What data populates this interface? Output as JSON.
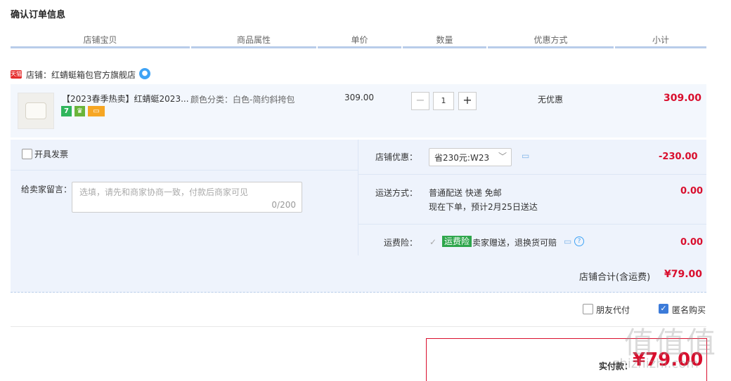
{
  "page_title": "确认订单信息",
  "columns": [
    "店铺宝贝",
    "商品属性",
    "单价",
    "数量",
    "优惠方式",
    "小计"
  ],
  "shop": {
    "badge": "天猫",
    "name": "店铺：红蜻蜓箱包官方旗舰店",
    "chat_icon": "chat-icon"
  },
  "item": {
    "title": "【2023春季热卖】红蜻蜓2023...",
    "attribute": "颜色分类：白色-简约斜挎包",
    "unit_price": "309.00",
    "quantity": "1",
    "minus_label": "−",
    "plus_label": "+",
    "promotion": "无优惠",
    "subtotal": "309.00",
    "tags": [
      {
        "text": "7",
        "color": "#2fb55c"
      },
      {
        "text": "♛",
        "color": "#69b43a"
      },
      {
        "text": "▭",
        "color": "#f6a623"
      }
    ]
  },
  "invoice": {
    "label": "开具发票"
  },
  "message": {
    "label": "给卖家留言：",
    "placeholder": "选填，请先和商家协商一致，付款后商家可见",
    "count": "0/200"
  },
  "discount": {
    "label": "店铺优惠：",
    "selected": "省230元:W23",
    "amount": "-230.00"
  },
  "shipping": {
    "label": "运送方式：",
    "method": "普通配送 快递 免邮",
    "eta": "现在下单，预计2月25日送达",
    "fee": "0.00"
  },
  "insurance": {
    "label": "运费险：",
    "badge": "运费险",
    "desc": "卖家赠送，退换货可赔",
    "fee": "0.00"
  },
  "shop_total": {
    "label": "店铺合计(含运费)",
    "value": "¥79.00"
  },
  "options": {
    "friend_pay": "朋友代付",
    "anonymous": "匿名购买"
  },
  "payment": {
    "label": "实付款：",
    "value": "¥79.00"
  },
  "watermark": {
    "big": "值值值",
    "small": "zhizhizhi.com"
  },
  "colors": {
    "accent_red": "#d90e2d",
    "header_line": "#b8cdea",
    "panel_bg": "#eef3fc"
  }
}
